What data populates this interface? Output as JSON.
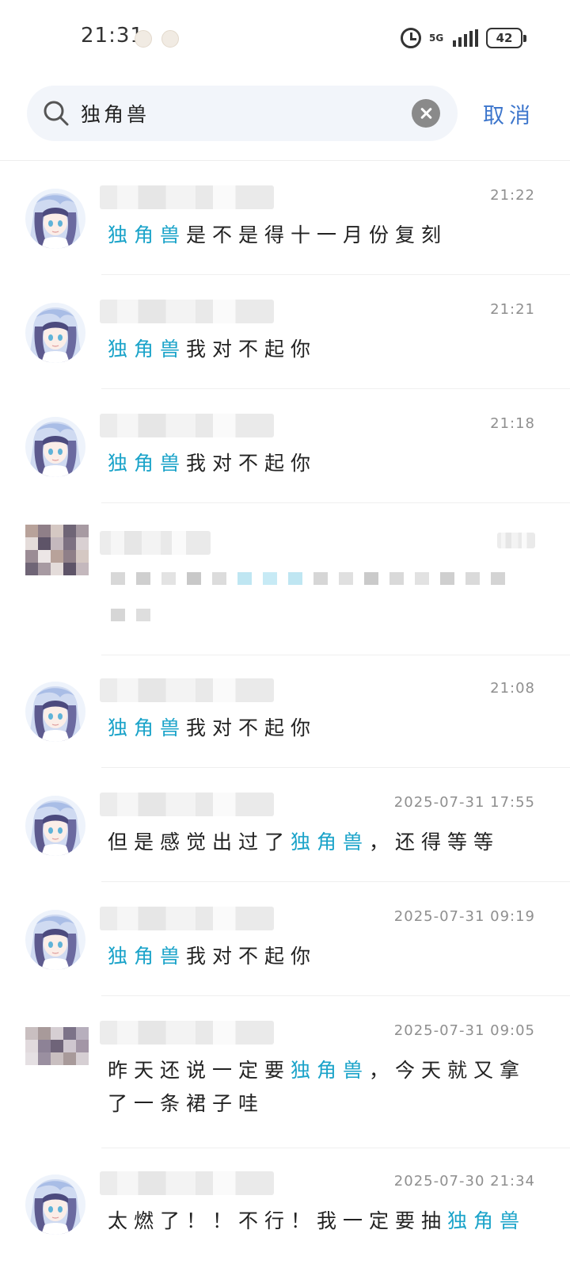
{
  "status_bar": {
    "time": "21:31",
    "network": "5G",
    "battery": "42"
  },
  "search": {
    "query": "独角兽",
    "cancel_label": "取消"
  },
  "results": [
    {
      "time": "21:22",
      "before": "",
      "keyword": "独角兽",
      "after": "是不是得十一月份复刻"
    },
    {
      "time": "21:21",
      "before": "",
      "keyword": "独角兽",
      "after": "我对不起你"
    },
    {
      "time": "21:18",
      "before": "",
      "keyword": "独角兽",
      "after": "我对不起你"
    },
    {
      "time": "21:08",
      "before": "",
      "keyword": "独角兽",
      "after": "我对不起你"
    },
    {
      "time": "2025-07-31 17:55",
      "before": "但是感觉出过了",
      "keyword": "独角兽",
      "after": "，还得等等"
    },
    {
      "time": "2025-07-31 09:19",
      "before": "",
      "keyword": "独角兽",
      "after": "我对不起你"
    },
    {
      "time": "2025-07-31 09:05",
      "before": "昨天还说一定要",
      "keyword": "独角兽",
      "after": "，今天就又拿了一条裙子哇"
    },
    {
      "time": "2025-07-30 21:34",
      "before": "太燃了！！不行！我一定要抽",
      "keyword": "独角兽",
      "after": ""
    }
  ],
  "icons": {
    "search": "search-icon",
    "clear": "clear-icon",
    "alarm": "alarm-icon",
    "signal": "signal-icon",
    "battery": "battery-icon",
    "avatar": "anime-avatar-icon"
  },
  "colors": {
    "highlight": "#1aa3c9",
    "cancel": "#3d76cc",
    "search_bg": "#f2f5fa"
  }
}
